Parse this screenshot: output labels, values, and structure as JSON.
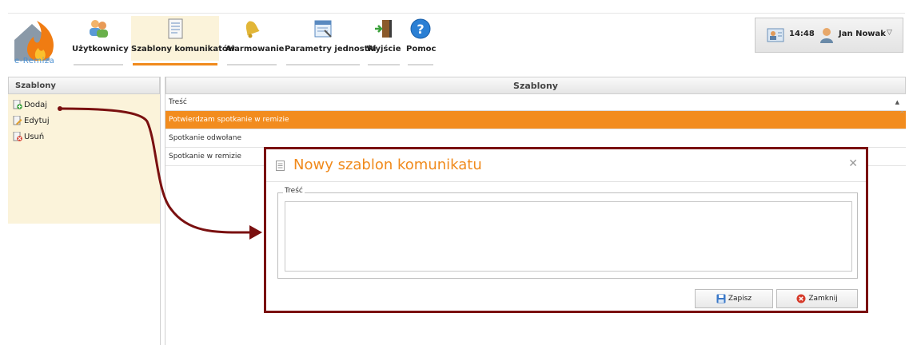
{
  "app": {
    "logo_text": "e-Remiza"
  },
  "nav": {
    "items": [
      {
        "label": "Użytkownicy",
        "icon": "users-icon"
      },
      {
        "label": "Szablony komunikatów",
        "icon": "document-icon",
        "active": true
      },
      {
        "label": "Alarmowanie",
        "icon": "bell-icon"
      },
      {
        "label": "Parametry jednostki",
        "icon": "settings-form-icon"
      },
      {
        "label": "Wyjście",
        "icon": "exit-door-icon"
      },
      {
        "label": "Pomoc",
        "icon": "help-icon"
      }
    ]
  },
  "user": {
    "time": "14:48",
    "name": "Jan Nowak"
  },
  "left": {
    "header": "Szablony",
    "actions": [
      {
        "label": "Dodaj",
        "icon": "add-icon"
      },
      {
        "label": "Edytuj",
        "icon": "edit-icon"
      },
      {
        "label": "Usuń",
        "icon": "delete-icon"
      }
    ]
  },
  "grid": {
    "title": "Szablony",
    "column": "Treść",
    "rows": [
      {
        "text": "Potwierdzam spotkanie w remizie",
        "selected": true
      },
      {
        "text": "Spotkanie odwołane"
      },
      {
        "text": "Spotkanie w remizie"
      }
    ]
  },
  "dialog": {
    "title": "Nowy szablon komunikatu",
    "field_label": "Treść",
    "field_value": "",
    "save_label": "Zapisz",
    "close_label": "Zamknij"
  },
  "colors": {
    "accent": "#f08a1c",
    "selected_row": "#f28c1e",
    "highlight_border": "#7a1010",
    "panel_bg": "#fbf3da"
  }
}
